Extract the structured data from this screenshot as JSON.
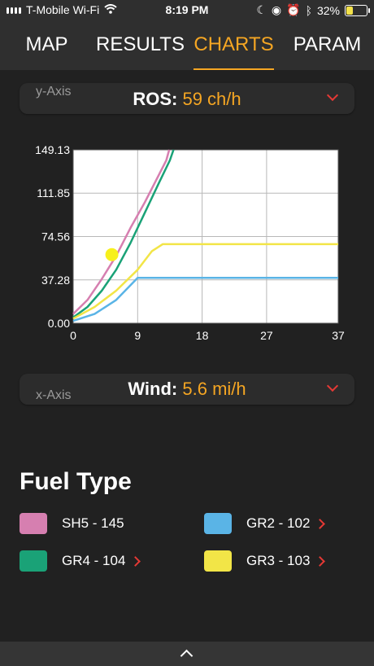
{
  "status": {
    "carrier": "T-Mobile Wi-Fi",
    "time": "8:19 PM",
    "battery": "32%"
  },
  "tabs": [
    {
      "label": "MAP",
      "active": false
    },
    {
      "label": "RESULTS",
      "active": false
    },
    {
      "label": "CHARTS",
      "active": true
    },
    {
      "label": "PARAM",
      "active": false
    }
  ],
  "y_axis_selector": {
    "axis_label": "y-Axis",
    "name": "ROS:",
    "value": "59 ch/h"
  },
  "x_axis_selector": {
    "axis_label": "x-Axis",
    "name": "Wind:",
    "value": "5.6 mi/h"
  },
  "fuel_type": {
    "title": "Fuel Type",
    "items": [
      {
        "label": "SH5 - 145",
        "color": "#d67fb0",
        "has_arrow": false
      },
      {
        "label": "GR2 - 102",
        "color": "#5ab4e6",
        "has_arrow": true
      },
      {
        "label": "GR4 - 104",
        "color": "#1aa277",
        "has_arrow": true
      },
      {
        "label": "GR3 - 103",
        "color": "#f2e547",
        "has_arrow": true
      }
    ]
  },
  "chart_data": {
    "type": "line",
    "xlabel": "",
    "ylabel": "",
    "xlim": [
      0,
      37
    ],
    "ylim": [
      0,
      149.13
    ],
    "x_ticks": [
      "0",
      "9",
      "18",
      "27",
      "37"
    ],
    "y_ticks": [
      "0.00",
      "37.28",
      "74.56",
      "111.85",
      "149.13"
    ],
    "grid": true,
    "series": [
      {
        "name": "SH5 - 145",
        "color": "#d67fb0",
        "points": [
          [
            0,
            8
          ],
          [
            2,
            20
          ],
          [
            4,
            38
          ],
          [
            6,
            58
          ],
          [
            8,
            82
          ],
          [
            10,
            104
          ],
          [
            12,
            128
          ],
          [
            13,
            140
          ],
          [
            13.4,
            149.13
          ]
        ]
      },
      {
        "name": "GR4 - 104",
        "color": "#1aa277",
        "points": [
          [
            0,
            5
          ],
          [
            2,
            14
          ],
          [
            4,
            28
          ],
          [
            6,
            46
          ],
          [
            8,
            69
          ],
          [
            10,
            95
          ],
          [
            12,
            121
          ],
          [
            13.5,
            140
          ],
          [
            14,
            149.13
          ]
        ]
      },
      {
        "name": "GR3 - 103",
        "color": "#f2e547",
        "points": [
          [
            0,
            4
          ],
          [
            3,
            14
          ],
          [
            6,
            28
          ],
          [
            9,
            46
          ],
          [
            11,
            62
          ],
          [
            12.5,
            68
          ],
          [
            37,
            68
          ]
        ]
      },
      {
        "name": "GR2 - 102",
        "color": "#5ab4e6",
        "points": [
          [
            0,
            2
          ],
          [
            3,
            8
          ],
          [
            6,
            20
          ],
          [
            9,
            39
          ],
          [
            37,
            39
          ]
        ]
      }
    ],
    "marker": {
      "x": 5.4,
      "y": 59,
      "color": "#f7f01c"
    }
  },
  "bottom": {
    "icon": "chevron-up-icon"
  }
}
